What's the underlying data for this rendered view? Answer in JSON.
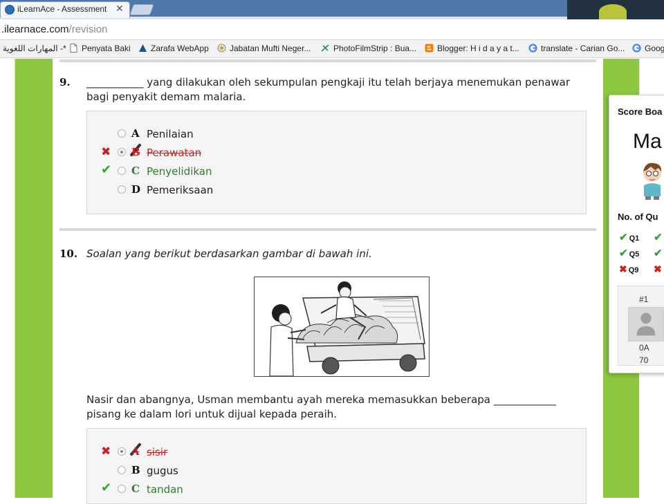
{
  "browser": {
    "tab_title": "iLearnAce - Assessment",
    "tab_close": "✕",
    "url_host": ".ilearnace.com",
    "url_path": "/revision",
    "bookmarks": [
      {
        "label": "المهارات اللغوية -*",
        "icon": "arabic-bookmark-icon"
      },
      {
        "label": "Penyata Baki",
        "icon": "page-icon"
      },
      {
        "label": "Zarafa WebApp",
        "icon": "zarafa-icon"
      },
      {
        "label": "Jabatan Mufti Neger...",
        "icon": "emblem-icon"
      },
      {
        "label": "PhotoFilmStrip : Bua...",
        "icon": "filmstrip-icon"
      },
      {
        "label": "Blogger: H i d a y a t...",
        "icon": "blogger-icon"
      },
      {
        "label": "translate - Carian Go...",
        "icon": "google-icon"
      },
      {
        "label": "Goog",
        "icon": "google-icon"
      }
    ]
  },
  "questions": [
    {
      "number": "9.",
      "text": "___________ yang dilakukan oleh sekumpulan pengkaji itu telah berjaya menemukan penawar bagi penyakit demam malaria.",
      "options": [
        {
          "letter": "A",
          "text": "Penilaian",
          "state": "none"
        },
        {
          "letter": "B",
          "text": "Perawatan",
          "state": "wrong"
        },
        {
          "letter": "C",
          "text": "Penyelidikan",
          "state": "correct"
        },
        {
          "letter": "D",
          "text": "Pemeriksaan",
          "state": "none"
        }
      ]
    },
    {
      "number": "10.",
      "instruction": "Soalan yang berikut berdasarkan gambar di bawah ini.",
      "text": "Nasir dan abangnya, Usman membantu ayah mereka memasukkan beberapa ____________ pisang ke dalam lori untuk dijual kepada peraih.",
      "options": [
        {
          "letter": "A",
          "text": "sisir",
          "state": "wrong"
        },
        {
          "letter": "B",
          "text": "gugus",
          "state": "none"
        },
        {
          "letter": "C",
          "text": "tandan",
          "state": "correct"
        }
      ]
    }
  ],
  "scoreboard": {
    "title": "Score Boa",
    "name": "Ma",
    "questions_label": "No. of Qu",
    "items": [
      {
        "label": "Q1",
        "result": "correct"
      },
      {
        "label": "Q5",
        "result": "correct"
      },
      {
        "label": "Q9",
        "result": "wrong"
      }
    ],
    "rank": "#1",
    "class": "0A",
    "score": "70"
  },
  "colors": {
    "side_green": "#8dc63f",
    "wrong": "#cc2222",
    "correct": "#2e7d2e"
  }
}
